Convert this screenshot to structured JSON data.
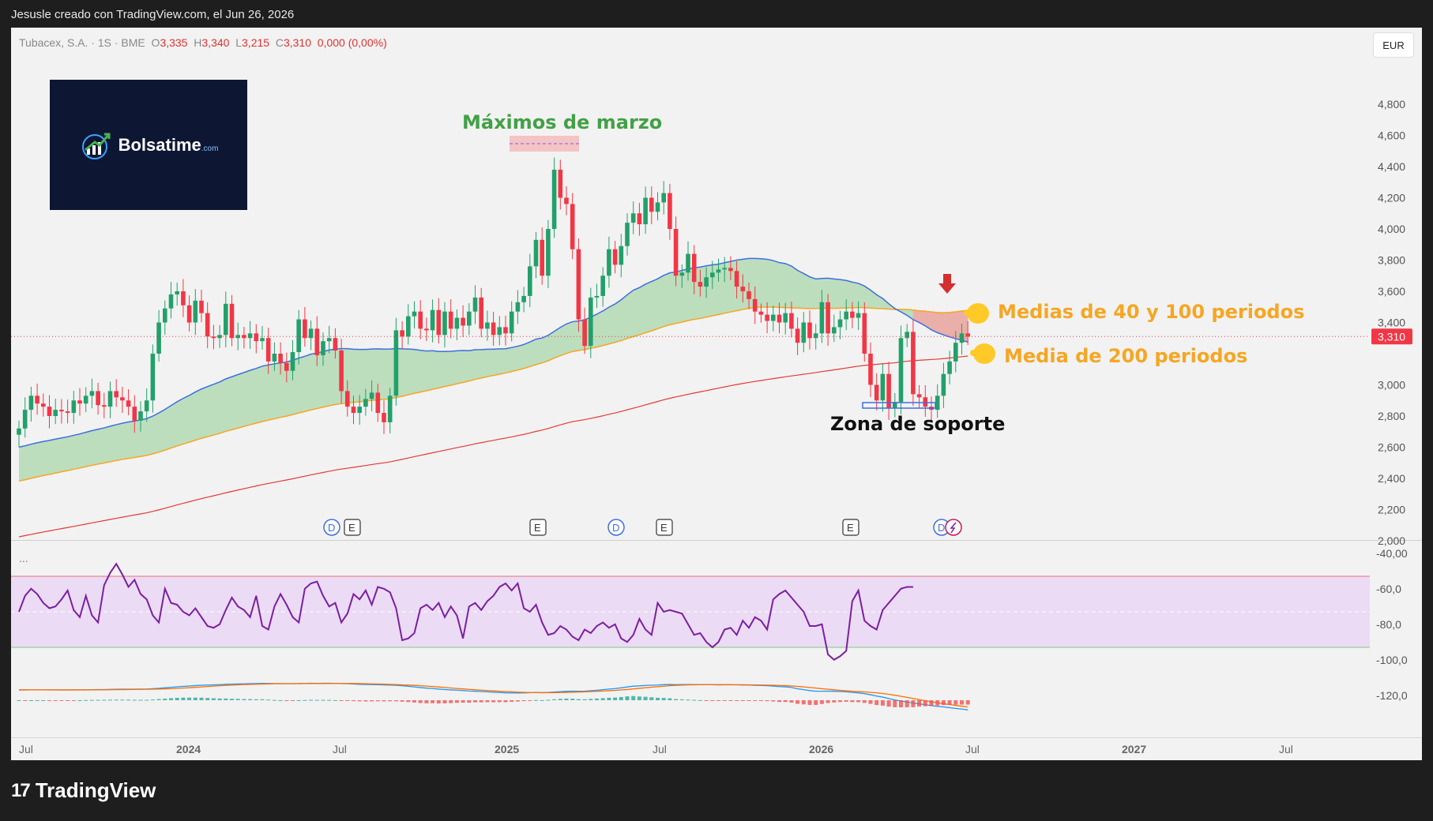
{
  "header": {
    "credit": "Jesusle creado con TradingView.com, el Jun 26, 2026",
    "symbol": "Tubacex, S.A. · 1S · BME",
    "ohlc": {
      "o_label": "O",
      "o": "3,335",
      "h_label": "H",
      "h": "3,340",
      "l_label": "L",
      "l": "3,215",
      "c_label": "C",
      "c": "3,310",
      "change": "0,000 (0,00%)"
    },
    "currency": "EUR"
  },
  "logo": {
    "brand": "Bolsatime",
    "brand_main": "Bolsa",
    "brand_accent": "time",
    "domain": ".com"
  },
  "footer": {
    "brand": "TradingView"
  },
  "colors": {
    "up": "#22a06b",
    "down": "#f23645",
    "ma40": "#3d6fe0",
    "ma100": "#f5a623",
    "ma200": "#e53935",
    "cloud_up": "#a5d6a7",
    "cloud_down": "#f5a3a3",
    "rsi": "#7b1fa2",
    "rsi_band": "#e9d5f5",
    "annot_green": "#43a047",
    "annot_orange": "#f5a623"
  },
  "chart_data": [
    {
      "type": "candlestick",
      "title": "",
      "x_ticks": [
        "Jul",
        "2024",
        "Jul",
        "2025",
        "Jul",
        "2026",
        "Jul",
        "2027",
        "Jul"
      ],
      "y_ticks": [
        "4,800",
        "4,600",
        "4,400",
        "4,200",
        "4,000",
        "3,800",
        "3,600",
        "3,400",
        "3,000",
        "2,800",
        "2,600",
        "2,400",
        "2,200",
        "2,000"
      ],
      "ylim": [
        1900,
        4950
      ],
      "last_price": "3,310",
      "closes": [
        2.72,
        2.84,
        2.93,
        2.88,
        2.86,
        2.8,
        2.84,
        2.83,
        2.82,
        2.9,
        2.88,
        2.93,
        2.96,
        2.87,
        2.86,
        2.96,
        2.92,
        2.9,
        2.86,
        2.77,
        2.83,
        2.9,
        3.2,
        3.4,
        3.49,
        3.58,
        3.6,
        3.51,
        3.4,
        3.54,
        3.46,
        3.31,
        3.3,
        3.32,
        3.52,
        3.3,
        3.32,
        3.3,
        3.33,
        3.28,
        3.3,
        3.15,
        3.2,
        3.14,
        3.09,
        3.21,
        3.42,
        3.3,
        3.36,
        3.19,
        3.28,
        3.3,
        3.22,
        2.96,
        2.86,
        2.82,
        2.86,
        2.91,
        2.95,
        2.82,
        2.76,
        2.93,
        3.35,
        3.31,
        3.44,
        3.47,
        3.36,
        3.35,
        3.48,
        3.32,
        3.47,
        3.36,
        3.43,
        3.38,
        3.47,
        3.56,
        3.36,
        3.4,
        3.32,
        3.37,
        3.33,
        3.47,
        3.53,
        3.57,
        3.76,
        3.93,
        3.7,
        4.0,
        4.38,
        4.2,
        4.16,
        3.87,
        3.42,
        3.25,
        3.56,
        3.57,
        3.7,
        3.87,
        3.77,
        3.89,
        4.04,
        4.1,
        4.03,
        4.2,
        4.11,
        4.17,
        4.23,
        4.0,
        3.7,
        3.72,
        3.84,
        3.66,
        3.63,
        3.69,
        3.72,
        3.74,
        3.75,
        3.73,
        3.63,
        3.6,
        3.55,
        3.47,
        3.45,
        3.41,
        3.45,
        3.4,
        3.46,
        3.36,
        3.27,
        3.4,
        3.3,
        3.33,
        3.53,
        3.33,
        3.37,
        3.42,
        3.47,
        3.43,
        3.46,
        3.2,
        3.0,
        2.9,
        3.07,
        2.85,
        2.89,
        3.3,
        3.34,
        2.94,
        2.92,
        2.86,
        2.84,
        2.93,
        3.07,
        3.15,
        3.27,
        3.33,
        3.31
      ],
      "cross_time_zones": [
        "#f5a3a3"
      ]
    },
    {
      "type": "line",
      "title": "",
      "series": [
        {
          "values": [
            50,
            59,
            63,
            60,
            55,
            52,
            53,
            57,
            62,
            51,
            47,
            59,
            48,
            44,
            65,
            72,
            77,
            71,
            64,
            68,
            60,
            57,
            48,
            44,
            63,
            55,
            54,
            50,
            48,
            52,
            47,
            42,
            41,
            43,
            51,
            58,
            53,
            51,
            47,
            59,
            42,
            40,
            53,
            60,
            54,
            47,
            44,
            63,
            66,
            67,
            59,
            53,
            55,
            44,
            49,
            60,
            57,
            62,
            54,
            64,
            63,
            61,
            52,
            34,
            35,
            38,
            52,
            54,
            51,
            55,
            47,
            53,
            48,
            35,
            53,
            55,
            51,
            56,
            59,
            64,
            66,
            62,
            66,
            52,
            50,
            54,
            44,
            37,
            38,
            42,
            40,
            36,
            34,
            40,
            38,
            42,
            44,
            41,
            43,
            35,
            33,
            37,
            46,
            40,
            37,
            55,
            50,
            51,
            50,
            49,
            43,
            37,
            38,
            33,
            30,
            33,
            40,
            41,
            37,
            45,
            41,
            47,
            45,
            40,
            57,
            60,
            62,
            58,
            54,
            50,
            42,
            42,
            43,
            26,
            23,
            25,
            28,
            56,
            62,
            45,
            42,
            40,
            51,
            55,
            59,
            63,
            64,
            64
          ]
        }
      ],
      "y_ticks": [
        "-40,00",
        "-60,0",
        "-80,0",
        "-100,0",
        "-120,0"
      ],
      "bands": {
        "upper": 70,
        "lower": 30
      }
    }
  ],
  "annotations": {
    "march_highs": "Máximos de marzo",
    "support_zone": "Zona de soporte",
    "ma_40_100": "Medias de 40 y 100 periodos",
    "ma_200": "Media de 200 periodos"
  },
  "events": [
    {
      "kind": "D",
      "icon": "dividend-icon"
    },
    {
      "kind": "E",
      "icon": "earnings-icon"
    },
    {
      "kind": "E",
      "icon": "earnings-icon"
    },
    {
      "kind": "D",
      "icon": "dividend-icon"
    },
    {
      "kind": "E",
      "icon": "earnings-icon"
    },
    {
      "kind": "E",
      "icon": "earnings-icon"
    },
    {
      "kind": "D",
      "icon": "dividend-icon"
    },
    {
      "kind": "S",
      "icon": "split-icon"
    }
  ],
  "panes": {
    "indicator_menu": "..."
  }
}
